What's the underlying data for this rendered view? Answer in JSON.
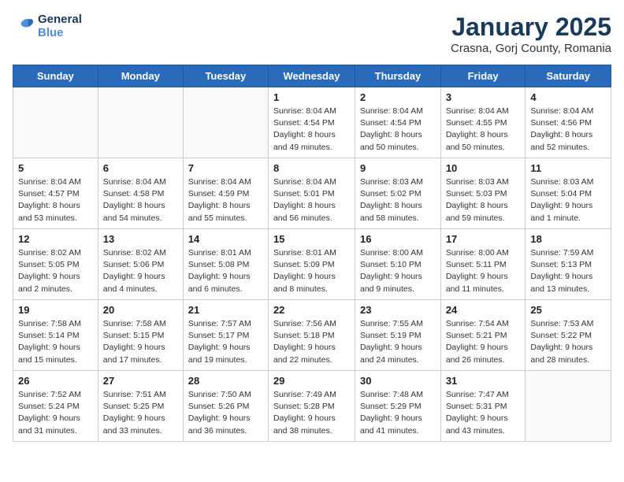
{
  "logo": {
    "line1": "General",
    "line2": "Blue"
  },
  "title": "January 2025",
  "subtitle": "Crasna, Gorj County, Romania",
  "headers": [
    "Sunday",
    "Monday",
    "Tuesday",
    "Wednesday",
    "Thursday",
    "Friday",
    "Saturday"
  ],
  "weeks": [
    [
      {
        "day": "",
        "info": ""
      },
      {
        "day": "",
        "info": ""
      },
      {
        "day": "",
        "info": ""
      },
      {
        "day": "1",
        "info": "Sunrise: 8:04 AM\nSunset: 4:54 PM\nDaylight: 8 hours\nand 49 minutes."
      },
      {
        "day": "2",
        "info": "Sunrise: 8:04 AM\nSunset: 4:54 PM\nDaylight: 8 hours\nand 50 minutes."
      },
      {
        "day": "3",
        "info": "Sunrise: 8:04 AM\nSunset: 4:55 PM\nDaylight: 8 hours\nand 50 minutes."
      },
      {
        "day": "4",
        "info": "Sunrise: 8:04 AM\nSunset: 4:56 PM\nDaylight: 8 hours\nand 52 minutes."
      }
    ],
    [
      {
        "day": "5",
        "info": "Sunrise: 8:04 AM\nSunset: 4:57 PM\nDaylight: 8 hours\nand 53 minutes."
      },
      {
        "day": "6",
        "info": "Sunrise: 8:04 AM\nSunset: 4:58 PM\nDaylight: 8 hours\nand 54 minutes."
      },
      {
        "day": "7",
        "info": "Sunrise: 8:04 AM\nSunset: 4:59 PM\nDaylight: 8 hours\nand 55 minutes."
      },
      {
        "day": "8",
        "info": "Sunrise: 8:04 AM\nSunset: 5:01 PM\nDaylight: 8 hours\nand 56 minutes."
      },
      {
        "day": "9",
        "info": "Sunrise: 8:03 AM\nSunset: 5:02 PM\nDaylight: 8 hours\nand 58 minutes."
      },
      {
        "day": "10",
        "info": "Sunrise: 8:03 AM\nSunset: 5:03 PM\nDaylight: 8 hours\nand 59 minutes."
      },
      {
        "day": "11",
        "info": "Sunrise: 8:03 AM\nSunset: 5:04 PM\nDaylight: 9 hours\nand 1 minute."
      }
    ],
    [
      {
        "day": "12",
        "info": "Sunrise: 8:02 AM\nSunset: 5:05 PM\nDaylight: 9 hours\nand 2 minutes."
      },
      {
        "day": "13",
        "info": "Sunrise: 8:02 AM\nSunset: 5:06 PM\nDaylight: 9 hours\nand 4 minutes."
      },
      {
        "day": "14",
        "info": "Sunrise: 8:01 AM\nSunset: 5:08 PM\nDaylight: 9 hours\nand 6 minutes."
      },
      {
        "day": "15",
        "info": "Sunrise: 8:01 AM\nSunset: 5:09 PM\nDaylight: 9 hours\nand 8 minutes."
      },
      {
        "day": "16",
        "info": "Sunrise: 8:00 AM\nSunset: 5:10 PM\nDaylight: 9 hours\nand 9 minutes."
      },
      {
        "day": "17",
        "info": "Sunrise: 8:00 AM\nSunset: 5:11 PM\nDaylight: 9 hours\nand 11 minutes."
      },
      {
        "day": "18",
        "info": "Sunrise: 7:59 AM\nSunset: 5:13 PM\nDaylight: 9 hours\nand 13 minutes."
      }
    ],
    [
      {
        "day": "19",
        "info": "Sunrise: 7:58 AM\nSunset: 5:14 PM\nDaylight: 9 hours\nand 15 minutes."
      },
      {
        "day": "20",
        "info": "Sunrise: 7:58 AM\nSunset: 5:15 PM\nDaylight: 9 hours\nand 17 minutes."
      },
      {
        "day": "21",
        "info": "Sunrise: 7:57 AM\nSunset: 5:17 PM\nDaylight: 9 hours\nand 19 minutes."
      },
      {
        "day": "22",
        "info": "Sunrise: 7:56 AM\nSunset: 5:18 PM\nDaylight: 9 hours\nand 22 minutes."
      },
      {
        "day": "23",
        "info": "Sunrise: 7:55 AM\nSunset: 5:19 PM\nDaylight: 9 hours\nand 24 minutes."
      },
      {
        "day": "24",
        "info": "Sunrise: 7:54 AM\nSunset: 5:21 PM\nDaylight: 9 hours\nand 26 minutes."
      },
      {
        "day": "25",
        "info": "Sunrise: 7:53 AM\nSunset: 5:22 PM\nDaylight: 9 hours\nand 28 minutes."
      }
    ],
    [
      {
        "day": "26",
        "info": "Sunrise: 7:52 AM\nSunset: 5:24 PM\nDaylight: 9 hours\nand 31 minutes."
      },
      {
        "day": "27",
        "info": "Sunrise: 7:51 AM\nSunset: 5:25 PM\nDaylight: 9 hours\nand 33 minutes."
      },
      {
        "day": "28",
        "info": "Sunrise: 7:50 AM\nSunset: 5:26 PM\nDaylight: 9 hours\nand 36 minutes."
      },
      {
        "day": "29",
        "info": "Sunrise: 7:49 AM\nSunset: 5:28 PM\nDaylight: 9 hours\nand 38 minutes."
      },
      {
        "day": "30",
        "info": "Sunrise: 7:48 AM\nSunset: 5:29 PM\nDaylight: 9 hours\nand 41 minutes."
      },
      {
        "day": "31",
        "info": "Sunrise: 7:47 AM\nSunset: 5:31 PM\nDaylight: 9 hours\nand 43 minutes."
      },
      {
        "day": "",
        "info": ""
      }
    ]
  ]
}
